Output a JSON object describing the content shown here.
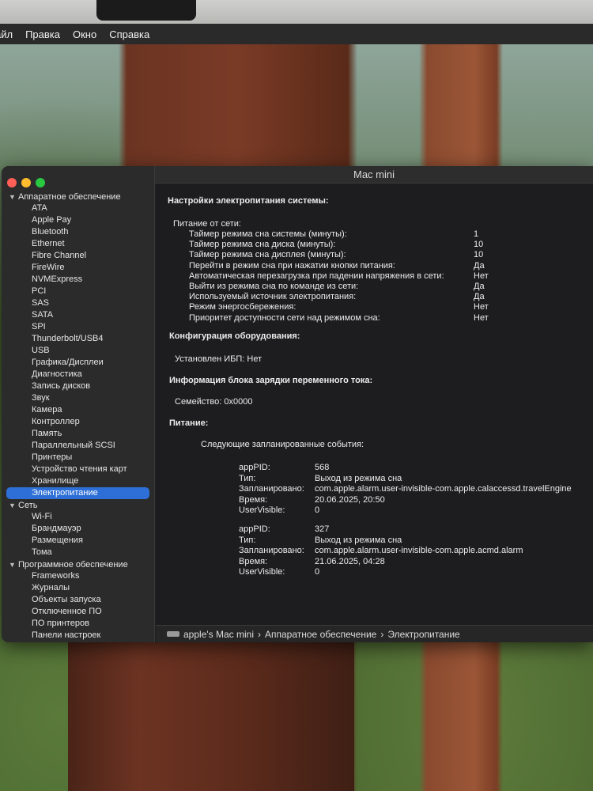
{
  "menubar": {
    "items": [
      "айл",
      "Правка",
      "Окно",
      "Справка"
    ]
  },
  "window": {
    "title": "Mac mini",
    "controls": {
      "close": "#fe5f57",
      "minimize": "#febc2e",
      "zoom": "#28c840"
    }
  },
  "sidebar": {
    "hardware": {
      "label": "Аппаратное обеспечение",
      "items": [
        "ATA",
        "Apple Pay",
        "Bluetooth",
        "Ethernet",
        "Fibre Channel",
        "FireWire",
        "NVMExpress",
        "PCI",
        "SAS",
        "SATA",
        "SPI",
        "Thunderbolt/USB4",
        "USB",
        "Графика/Дисплеи",
        "Диагностика",
        "Запись дисков",
        "Звук",
        "Камера",
        "Контроллер",
        "Память",
        "Параллельный SCSI",
        "Принтеры",
        "Устройство чтения карт",
        "Хранилище",
        "Электропитание"
      ],
      "selected": "Электропитание"
    },
    "network": {
      "label": "Сеть",
      "items": [
        "Wi-Fi",
        "Брандмауэр",
        "Размещения",
        "Тома"
      ]
    },
    "software": {
      "label": "Программное обеспечение",
      "items": [
        "Frameworks",
        "Журналы",
        "Объекты запуска",
        "Отключенное ПО",
        "ПО принтеров",
        "Панели настроек"
      ]
    }
  },
  "content": {
    "system_power_heading": "Настройки электропитания системы:",
    "ac_power_label": "Питание от сети:",
    "ac_settings": [
      {
        "label": "Таймер режима сна системы (минуты):",
        "value": "1"
      },
      {
        "label": "Таймер режима сна диска (минуты):",
        "value": "10"
      },
      {
        "label": "Таймер режима сна дисплея (минуты):",
        "value": "10"
      },
      {
        "label": "Перейти в режим сна при нажатии кнопки питания:",
        "value": "Да"
      },
      {
        "label": "Автоматическая перезагрузка при падении напряжения в сети:",
        "value": "Нет"
      },
      {
        "label": "Выйти из режима сна по команде из сети:",
        "value": "Да"
      },
      {
        "label": "Используемый источник электропитания:",
        "value": "Да"
      },
      {
        "label": "Режим энергосбережения:",
        "value": "Нет"
      },
      {
        "label": "Приоритет доступности сети над режимом сна:",
        "value": "Нет"
      }
    ],
    "hardware_config_heading": "Конфигурация оборудования:",
    "ups_installed": "Установлен ИБП:  Нет",
    "ac_charger_heading": "Информация блока зарядки переменного тока:",
    "family": "Семейство:   0x0000",
    "power_heading": "Питание:",
    "scheduled_heading": "Следующие запланированные события:",
    "events": [
      {
        "rows": [
          {
            "label": "appPID:",
            "value": "568"
          },
          {
            "label": "Тип:",
            "value": "Выход из режима сна"
          },
          {
            "label": "Запланировано:",
            "value": "com.apple.alarm.user-invisible-com.apple.calaccessd.travelEngine"
          },
          {
            "label": "Время:",
            "value": "20.06.2025, 20:50"
          },
          {
            "label": "UserVisible:",
            "value": "0"
          }
        ]
      },
      {
        "rows": [
          {
            "label": "appPID:",
            "value": "327"
          },
          {
            "label": "Тип:",
            "value": "Выход из режима сна"
          },
          {
            "label": "Запланировано:",
            "value": "com.apple.alarm.user-invisible-com.apple.acmd.alarm"
          },
          {
            "label": "Время:",
            "value": "21.06.2025, 04:28"
          },
          {
            "label": "UserVisible:",
            "value": "0"
          }
        ]
      }
    ]
  },
  "pathbar": {
    "device": "apple's Mac mini",
    "section": "Аппаратное обеспечение",
    "page": "Электропитание",
    "separator": "›"
  }
}
